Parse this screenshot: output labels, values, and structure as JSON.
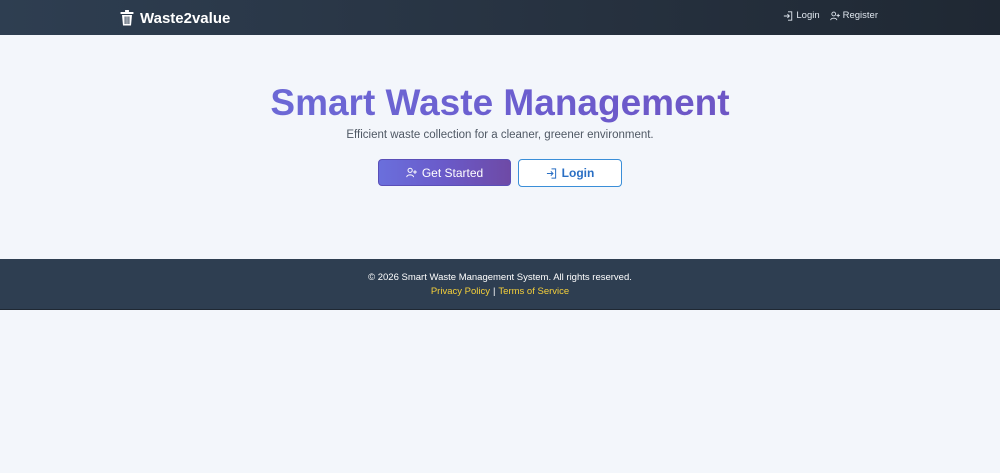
{
  "navbar": {
    "brand": "Waste2value",
    "links": [
      {
        "label": "Login",
        "icon": "login-icon"
      },
      {
        "label": "Register",
        "icon": "register-icon"
      }
    ]
  },
  "hero": {
    "title": "Smart Waste Management",
    "subtitle": "Efficient waste collection for a cleaner, greener environment.",
    "primary_button": "Get Started",
    "secondary_button": "Login"
  },
  "footer": {
    "copyright": "© 2026 Smart Waste Management System. All rights reserved.",
    "privacy": "Privacy Policy",
    "separator": "|",
    "terms": "Terms of Service"
  },
  "colors": {
    "navbar_bg": "#2e3e51",
    "accent_purple": "#6a5fd0",
    "accent_blue": "#2a6fc4",
    "footer_link": "#f4cf3a",
    "page_bg": "#f3f6fb"
  }
}
